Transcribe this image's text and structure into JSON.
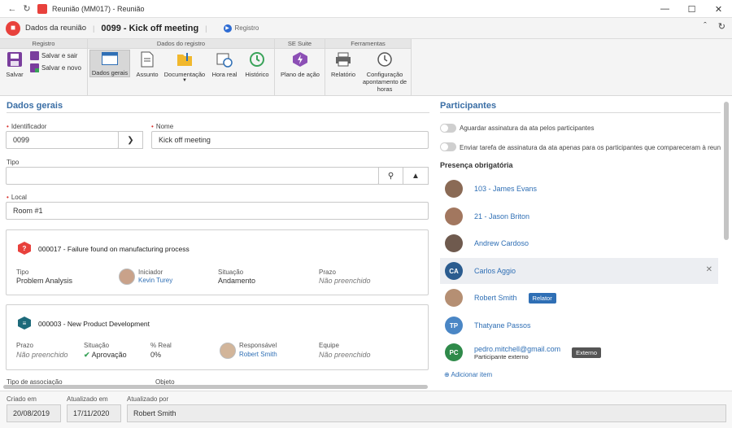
{
  "window": {
    "title": "Reunião (MM017) - Reunião"
  },
  "header": {
    "app_name": "Dados da reunião",
    "record_title": "0099 - Kick off meeting",
    "status": "Registro"
  },
  "ribbon": {
    "groups": [
      "Registro",
      "Dados do registro",
      "SE Suite",
      "Ferramentas"
    ],
    "save": "Salvar",
    "save_exit": "Salvar e sair",
    "save_new": "Salvar e novo",
    "general": "Dados gerais",
    "subject": "Assunto",
    "docs": "Documentação",
    "realtime": "Hora real",
    "history": "Histórico",
    "action_plan": "Plano de ação",
    "report": "Relatório",
    "config_line1": "Configuração",
    "config_line2": "apontamento de",
    "config_line3": "horas"
  },
  "general": {
    "title": "Dados gerais",
    "id_label": "Identificador",
    "id_value": "0099",
    "name_label": "Nome",
    "name_value": "Kick off meeting",
    "type_label": "Tipo",
    "type_value": "",
    "location_label": "Local",
    "location_value": "Room #1"
  },
  "card1": {
    "title": "000017 - Failure found on manufacturing process",
    "type_k": "Tipo",
    "type_v": "Problem Analysis",
    "starter_k": "Iniciador",
    "starter_v": "Kevin Turey",
    "status_k": "Situação",
    "status_v": "Andamento",
    "due_k": "Prazo",
    "due_v": "Não preenchido"
  },
  "card2": {
    "title": "000003 - New Product Development",
    "due_k": "Prazo",
    "due_v": "Não preenchido",
    "status_k": "Situação",
    "status_v": "Aprovação",
    "real_k": "% Real",
    "real_v": "0%",
    "resp_k": "Responsável",
    "resp_v": "Robert Smith",
    "team_k": "Equipe",
    "team_v": "Não preenchido"
  },
  "cut_labels": {
    "assoc": "Tipo de associação",
    "object": "Objeto"
  },
  "participants": {
    "title": "Participantes",
    "toggle1": "Aguardar assinatura da ata pelos participantes",
    "toggle2": "Enviar tarefa de assinatura da ata apenas para os participantes que compareceram à reun",
    "mandatory": "Presença obrigatória",
    "people": [
      {
        "name": "103 - James Evans"
      },
      {
        "name": "21 - Jason Briton"
      },
      {
        "name": "Andrew Cardoso"
      },
      {
        "name": "Carlos Aggio",
        "initials": "CA"
      },
      {
        "name": "Robert Smith",
        "badge": "Relator"
      },
      {
        "name": "Thatyane Passos",
        "initials": "TP"
      },
      {
        "name": "pedro.mitchell@gmail.com",
        "initials": "PC",
        "sub": "Participante externo",
        "badge": "Externo"
      }
    ],
    "add_item": "Adicionar item"
  },
  "footer": {
    "created_label": "Criado em",
    "created_value": "20/08/2019",
    "updated_label": "Atualizado em",
    "updated_value": "17/11/2020",
    "updated_by_label": "Atualizado por",
    "updated_by_value": "Robert Smith"
  },
  "colors": {
    "accent": "#3a6ea5",
    "link": "#2f6fb5",
    "app_icon": "#e8413c",
    "badge_relator": "#2f6fb5",
    "badge_externo": "#555555"
  }
}
